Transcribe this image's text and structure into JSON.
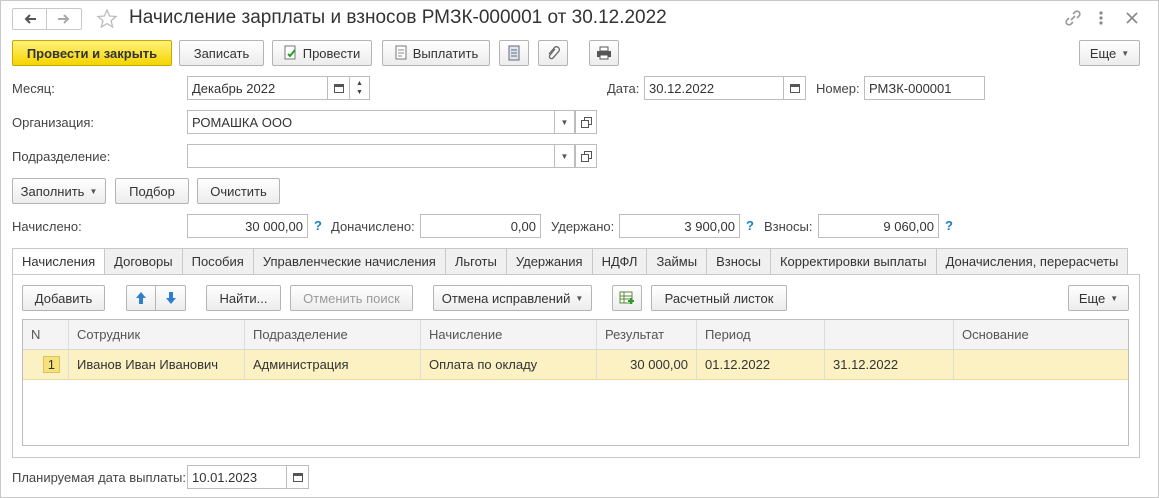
{
  "window": {
    "title": "Начисление зарплаты и взносов РМЗК-000001 от 30.12.2022",
    "nav_icons": [
      "arrow-left-icon",
      "arrow-right-icon",
      "star-icon"
    ],
    "window_icons": [
      "link-icon",
      "more-vertical-icon",
      "close-icon"
    ]
  },
  "toolbar": {
    "post_close": "Провести и закрыть",
    "save": "Записать",
    "post": "Провести",
    "pay": "Выплатить",
    "more": "Еще"
  },
  "header": {
    "month_label": "Месяц:",
    "month_value": "Декабрь 2022",
    "date_label": "Дата:",
    "date_value": "30.12.2022",
    "number_label": "Номер:",
    "number_value": "РМЗК-000001",
    "org_label": "Организация:",
    "org_value": "РОМАШКА ООО",
    "dept_label": "Подразделение:",
    "dept_value": ""
  },
  "actions": {
    "fill": "Заполнить",
    "select": "Подбор",
    "clear": "Очистить"
  },
  "totals": {
    "accrued_label": "Начислено:",
    "accrued_value": "30 000,00",
    "extra_label": "Доначислено:",
    "extra_value": "0,00",
    "withheld_label": "Удержано:",
    "withheld_value": "3 900,00",
    "contrib_label": "Взносы:",
    "contrib_value": "9 060,00",
    "help": "?"
  },
  "tabs": [
    "Начисления",
    "Договоры",
    "Пособия",
    "Управленческие начисления",
    "Льготы",
    "Удержания",
    "НДФЛ",
    "Займы",
    "Взносы",
    "Корректировки выплаты",
    "Доначисления, перерасчеты"
  ],
  "table_toolbar": {
    "add": "Добавить",
    "find": "Найти...",
    "cancel_search": "Отменить поиск",
    "cancel_fixes": "Отмена исправлений",
    "payslip": "Расчетный листок",
    "more": "Еще"
  },
  "table": {
    "columns": [
      "N",
      "Сотрудник",
      "Подразделение",
      "Начисление",
      "Результат",
      "Период",
      "",
      "Основание"
    ],
    "rows": [
      [
        "1",
        "Иванов Иван Иванович",
        "Администрация",
        "Оплата по окладу",
        "30 000,00",
        "01.12.2022",
        "31.12.2022",
        ""
      ]
    ]
  },
  "footer": {
    "pay_date_label": "Планируемая дата выплаты:",
    "pay_date_value": "10.01.2023"
  },
  "colors": {
    "primary_button": "#f5d400",
    "selected_row": "#fbf1c3",
    "help_mark": "#1a7fc4",
    "arrow_button": "#2f7fd1"
  }
}
